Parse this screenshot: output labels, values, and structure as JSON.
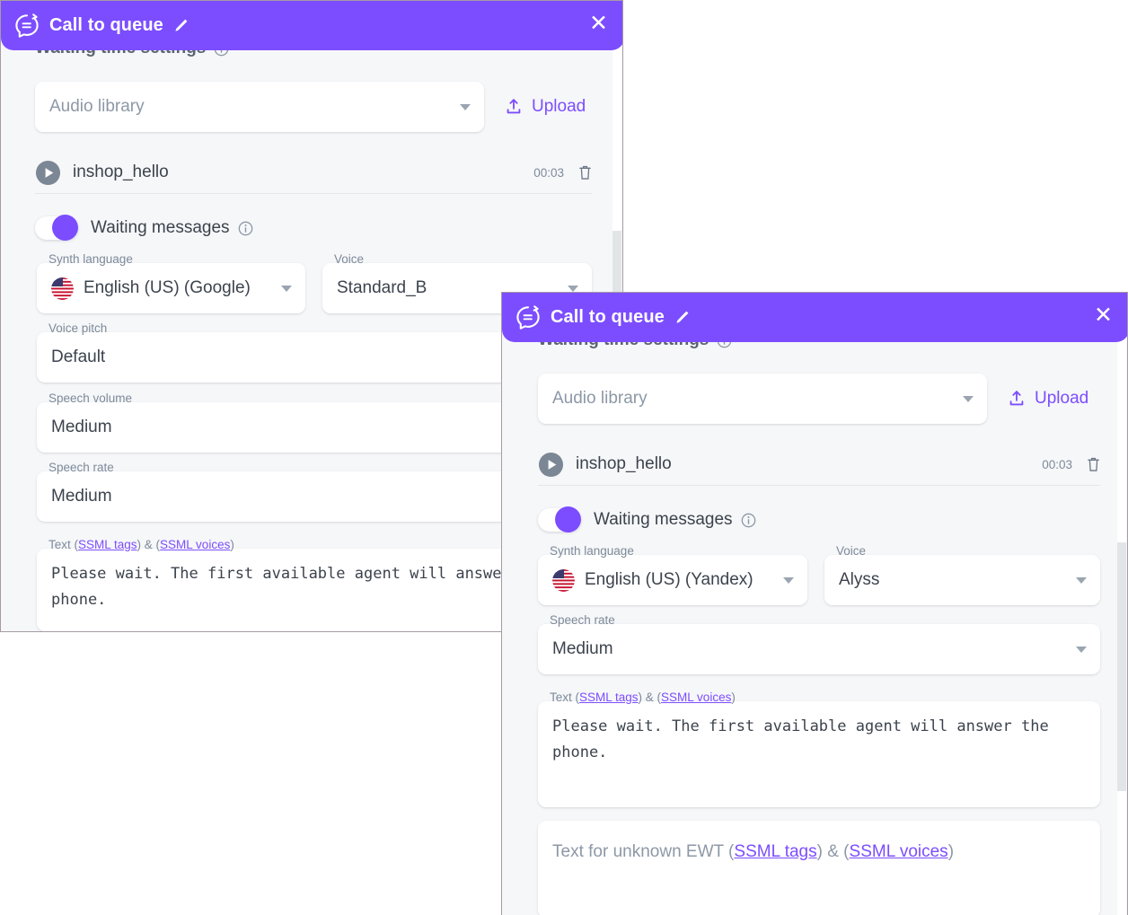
{
  "theme": {
    "accent": "#7c4dff",
    "title_bar_bg": "#7c4dff",
    "modal_bg": "#f6f7f9",
    "field_bg": "#ffffff",
    "label_color": "#7d8a99",
    "value_color": "#3c434d",
    "link_color": "#7c4dff"
  },
  "windows": [
    {
      "id": "back",
      "titlebar": {
        "app_icon": "chat-bubble-icon",
        "title": "Call to queue",
        "edit_icon": "pencil-icon",
        "close_icon": "close-icon",
        "close_glyph": "✕"
      },
      "section": {
        "heading": "Waiting time settings",
        "info_icon": "info-icon"
      },
      "audio_source": {
        "label": "",
        "placeholder": "Audio library",
        "value": "",
        "caret_icon": "chevron-down-icon"
      },
      "upload": {
        "label": "Upload",
        "icon": "upload-icon"
      },
      "audio_item": {
        "play_icon": "play-icon",
        "name": "inshop_hello",
        "duration": "00:03",
        "delete_icon": "trash-icon"
      },
      "waiting_messages": {
        "label": "Waiting messages",
        "enabled": true,
        "info_icon": "info-icon"
      },
      "fields": [
        {
          "name": "synth-language",
          "label": "Synth language",
          "value": "English (US) (Google)",
          "flag": "us-flag-icon",
          "has_caret": true
        },
        {
          "name": "voice",
          "label": "Voice",
          "value": "Standard_B",
          "flag": null,
          "has_caret": true
        },
        {
          "name": "voice-pitch",
          "label": "Voice pitch",
          "value": "Default",
          "flag": null,
          "has_caret": true
        },
        {
          "name": "speech-volume",
          "label": "Speech volume",
          "value": "Medium",
          "flag": null,
          "has_caret": true
        },
        {
          "name": "speech-rate",
          "label": "Speech rate",
          "value": "Medium",
          "flag": null,
          "has_caret": true
        }
      ],
      "text_field": {
        "label_prefix": "Text (",
        "label_link1": "SSML tags",
        "label_mid": ") & (",
        "label_link2": "SSML voices",
        "label_suffix": ")",
        "value": "Please wait. The first available agent will answer the phone."
      }
    },
    {
      "id": "front",
      "titlebar": {
        "app_icon": "chat-bubble-icon",
        "title": "Call to queue",
        "edit_icon": "pencil-icon",
        "close_icon": "close-icon",
        "close_glyph": "✕"
      },
      "section": {
        "heading": "Waiting time settings",
        "info_icon": "info-icon"
      },
      "audio_source": {
        "label": "",
        "placeholder": "Audio library",
        "value": "",
        "caret_icon": "chevron-down-icon"
      },
      "upload": {
        "label": "Upload",
        "icon": "upload-icon"
      },
      "audio_item": {
        "play_icon": "play-icon",
        "name": "inshop_hello",
        "duration": "00:03",
        "delete_icon": "trash-icon"
      },
      "waiting_messages": {
        "label": "Waiting messages",
        "enabled": true,
        "info_icon": "info-icon"
      },
      "fields": [
        {
          "name": "synth-language",
          "label": "Synth language",
          "value": "English (US) (Yandex)",
          "flag": "us-flag-icon",
          "has_caret": true
        },
        {
          "name": "voice",
          "label": "Voice",
          "value": "Alyss",
          "flag": null,
          "has_caret": true
        },
        {
          "name": "speech-rate",
          "label": "Speech rate",
          "value": "Medium",
          "flag": null,
          "has_caret": true
        }
      ],
      "text_field": {
        "label_prefix": "Text (",
        "label_link1": "SSML tags",
        "label_mid": ") & (",
        "label_link2": "SSML voices",
        "label_suffix": ")",
        "value": "Please wait. The first available agent will answer the phone."
      },
      "ewt_field": {
        "placeholder_prefix": "Text for unknown EWT (",
        "placeholder_link1": "SSML tags",
        "placeholder_mid": ") & (",
        "placeholder_link2": "SSML voices",
        "placeholder_suffix": ")",
        "value": ""
      }
    }
  ]
}
